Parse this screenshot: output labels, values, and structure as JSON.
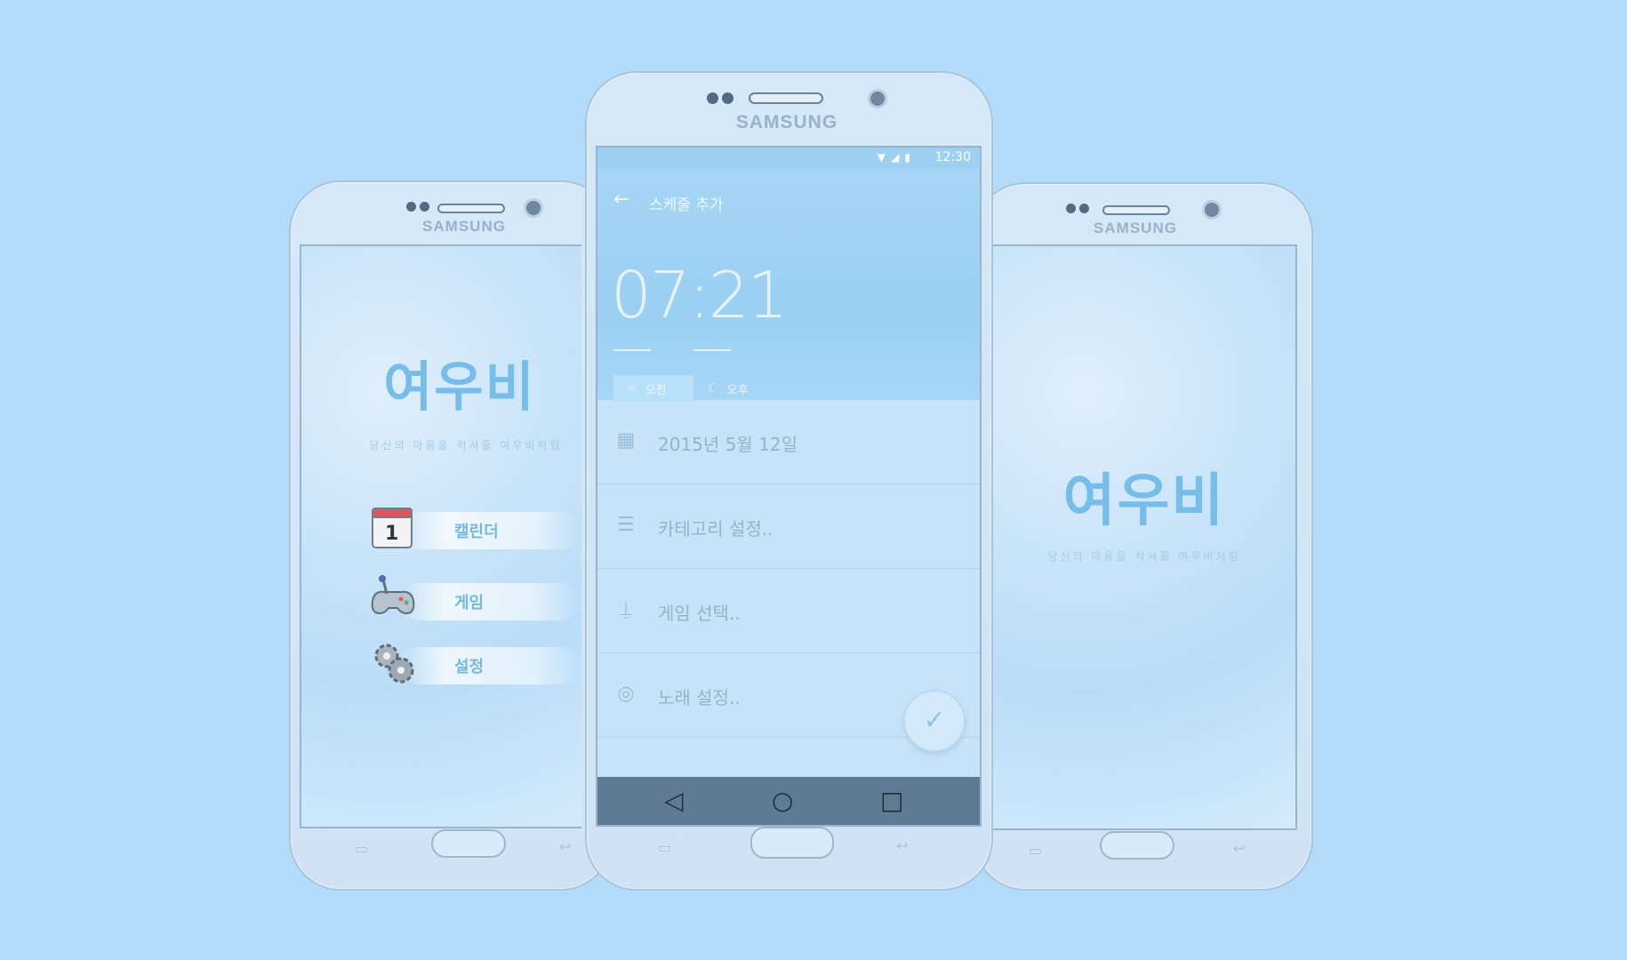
{
  "device": {
    "brand": "SAMSUNG"
  },
  "app": {
    "logo": "여우비",
    "tagline": "당신의 마음을 적셔줄 여우비처럼"
  },
  "left_screen": {
    "menu": [
      {
        "label": "캘린더",
        "icon": "calendar-icon"
      },
      {
        "label": "게임",
        "icon": "gamepad-icon"
      },
      {
        "label": "설정",
        "icon": "gear-icon"
      }
    ]
  },
  "center_screen": {
    "status": {
      "time": "12:30",
      "icons": [
        "wifi-icon",
        "signal-icon",
        "battery-icon"
      ]
    },
    "header": {
      "back_icon": "back-arrow-icon",
      "title": "스케줄 추가"
    },
    "time": "07:21",
    "am_label": "오전",
    "pm_label": "오후",
    "fields": [
      {
        "icon": "calendar-grid-icon",
        "text": "2015년 5월 12일"
      },
      {
        "icon": "list-icon",
        "text": "카테고리 설정.."
      },
      {
        "icon": "joystick-icon",
        "text": "게임 선택.."
      },
      {
        "icon": "music-disc-icon",
        "text": "노래 설정.."
      }
    ],
    "fab_icon": "check-icon",
    "nav": [
      "back-triangle-icon",
      "home-circle-icon",
      "recents-square-icon"
    ]
  },
  "colors": {
    "background": "#b3dcfa",
    "accent": "#76bde9",
    "nav_bar": "#5f7b93"
  }
}
